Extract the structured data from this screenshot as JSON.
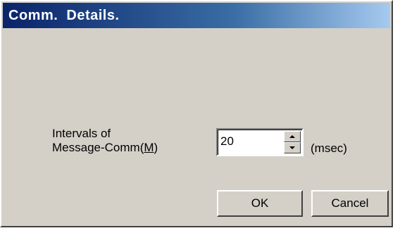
{
  "window": {
    "title": "Comm.  Details."
  },
  "form": {
    "label_line1": "Intervals of",
    "label_line2_prefix": "Message-Comm(",
    "label_line2_accel": "M",
    "label_line2_suffix": ")",
    "interval_value": "20",
    "unit": "(msec)"
  },
  "buttons": {
    "ok_label": "OK",
    "cancel_label": "Cancel"
  },
  "colors": {
    "dialog_face": "#d4d0c8",
    "titlebar_start": "#0a246a",
    "titlebar_end": "#a6caf0",
    "title_text": "#ffffff"
  },
  "icons": {
    "spin_up": "arrow-up-icon",
    "spin_down": "arrow-down-icon"
  }
}
